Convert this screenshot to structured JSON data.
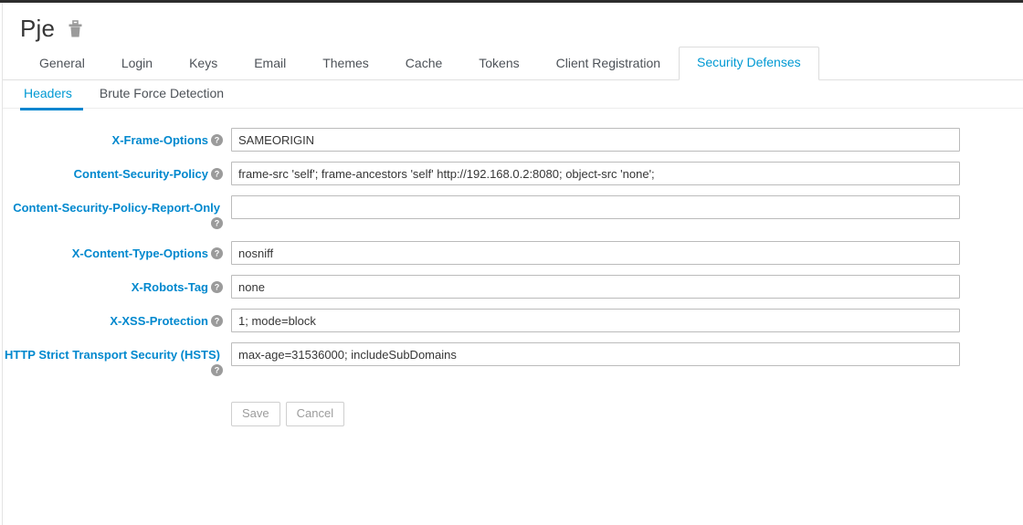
{
  "header": {
    "title": "Pje",
    "delete_icon": "trash-icon"
  },
  "tabs": [
    {
      "label": "General",
      "active": false
    },
    {
      "label": "Login",
      "active": false
    },
    {
      "label": "Keys",
      "active": false
    },
    {
      "label": "Email",
      "active": false
    },
    {
      "label": "Themes",
      "active": false
    },
    {
      "label": "Cache",
      "active": false
    },
    {
      "label": "Tokens",
      "active": false
    },
    {
      "label": "Client Registration",
      "active": false
    },
    {
      "label": "Security Defenses",
      "active": true
    }
  ],
  "subtabs": [
    {
      "label": "Headers",
      "active": true
    },
    {
      "label": "Brute Force Detection",
      "active": false
    }
  ],
  "form": {
    "fields": [
      {
        "label": "X-Frame-Options",
        "value": "SAMEORIGIN",
        "placeholder": "",
        "help_icon": "help-circle-icon"
      },
      {
        "label": "Content-Security-Policy",
        "value": "frame-src 'self'; frame-ancestors 'self' http://192.168.0.2:8080; object-src 'none';",
        "placeholder": "",
        "help_icon": "help-circle-icon"
      },
      {
        "label": "Content-Security-Policy-Report-Only",
        "value": "",
        "placeholder": "",
        "help_icon": "help-circle-icon"
      },
      {
        "label": "X-Content-Type-Options",
        "value": "nosniff",
        "placeholder": "",
        "help_icon": "help-circle-icon"
      },
      {
        "label": "X-Robots-Tag",
        "value": "none",
        "placeholder": "",
        "help_icon": "help-circle-icon"
      },
      {
        "label": "X-XSS-Protection",
        "value": "1; mode=block",
        "placeholder": "",
        "help_icon": "help-circle-icon"
      },
      {
        "label": "HTTP Strict Transport Security (HSTS)",
        "value": "max-age=31536000; includeSubDomains",
        "placeholder": "",
        "help_icon": "help-circle-icon"
      }
    ],
    "save_label": "Save",
    "cancel_label": "Cancel"
  },
  "colors": {
    "accent": "#0088ce",
    "active_tab_text": "#0099d3",
    "subtab_underline": "#0085cf",
    "text": "#4d5258",
    "title": "#363636",
    "input_border": "#bbbbbb",
    "disabled_button_text": "#9c9c9c",
    "top_strip": "#2d2d2d"
  }
}
